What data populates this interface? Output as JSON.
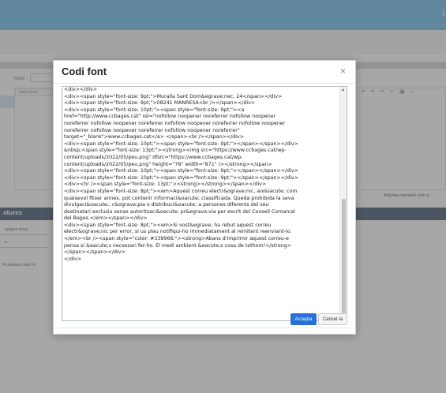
{
  "topbar": {
    "edge_letter": "i"
  },
  "background": {
    "name_label": "Nom:",
    "font_select": "Sans Serif",
    "toolbar_icons": "≡ ≡ ≡ ≡ ≡ ▣ ⌕",
    "attach_text": "Adjunta contacte com a",
    "section_title": "atures",
    "select_value": "satges nous",
    "select2_value": "u",
    "radio_label": "Al damunt dels m"
  },
  "modal": {
    "title": "Codi font",
    "close_label": "×",
    "accept_label": "Accepta",
    "cancel_label": "Cancel·la",
    "code_lines": [
      "<div></div>",
      "<div><span style=\"font-size: 9pt;\">Muralla Sant Dom&egrave;nec, 24</span></div>",
      "<div><span style=\"font-size: 9pt;\">08241 MANRESA<br /></span></div>",
      "<div><span style=\"font-size: 10pt;\"><span style=\"font-size: 9pt;\"><a",
      "href=\"http://www.ccbages.cat\" rel=\"nofollow noopener noreferrer nofollow noopener",
      "noreferrer nofollow noopener noreferrer nofollow noopener noreferrer nofollow noopener",
      "noreferrer nofollow noopener noreferrer nofollow noopener noreferrer\"",
      "target=\"_blank\">www.ccbages.cat</a> </span><br /></span></div>",
      "<div><span style=\"font-size: 10pt;\"><span style=\"font-size: 9pt;\"></span></span></div>",
      "&nbsp;<span style=\"font-size: 13pt;\"><strong><img src=\"https://www.ccbages.cat/wp-",
      "content/uploads/2022/05/peu.png\" dfsrc=\"https://www.ccbages.cat/wp-",
      "content/uploads/2022/05/peu.png\" height=\"78\" width=\"871\" /></strong></span>",
      "<div><span style=\"font-size: 10pt;\"><span style=\"font-size: 9pt;\"></span></span></div>",
      "<div><span style=\"font-size: 10pt;\"><span style=\"font-size: 9pt;\"></span></span></div>",
      "<div><hr /><span style=\"font-size: 13pt;\"><strong></strong></span></div>",
      "<div><span style=\"font-size: 8pt;\"><em>Aquest correu electr&ograve;nic, aix&iacute; com",
      "qualsevol fitxer annex, pot contenir informaci&oacute; classificada. Queda prohibida la seva",
      "divulgaci&oacute;, c&ograve;pia o distribuci&oacute; a persones diferents del seu",
      "destinatari exclusiu sense autoritzaci&oacute; pr&egrave;via per escrit del Consell Comarcal",
      "del Bages.</em></span></div>",
      "<div><span style=\"font-size: 8pt;\"><em>Si vost&egrave; ha rebut aquest correu",
      "electr&ograve;nic per error, si us plau notifiqui-ho immediatament al remitent reenviant-lo.",
      "</em><br /><span style=\"color: #339966;\"><strong>Abans d'imprimir aquest correu-e",
      "pensa si &eacute;s necessari fer-ho. El medi ambient &eacute;s cosa de tothom!</strong>",
      "</span></span></div>",
      "</div>"
    ]
  }
}
